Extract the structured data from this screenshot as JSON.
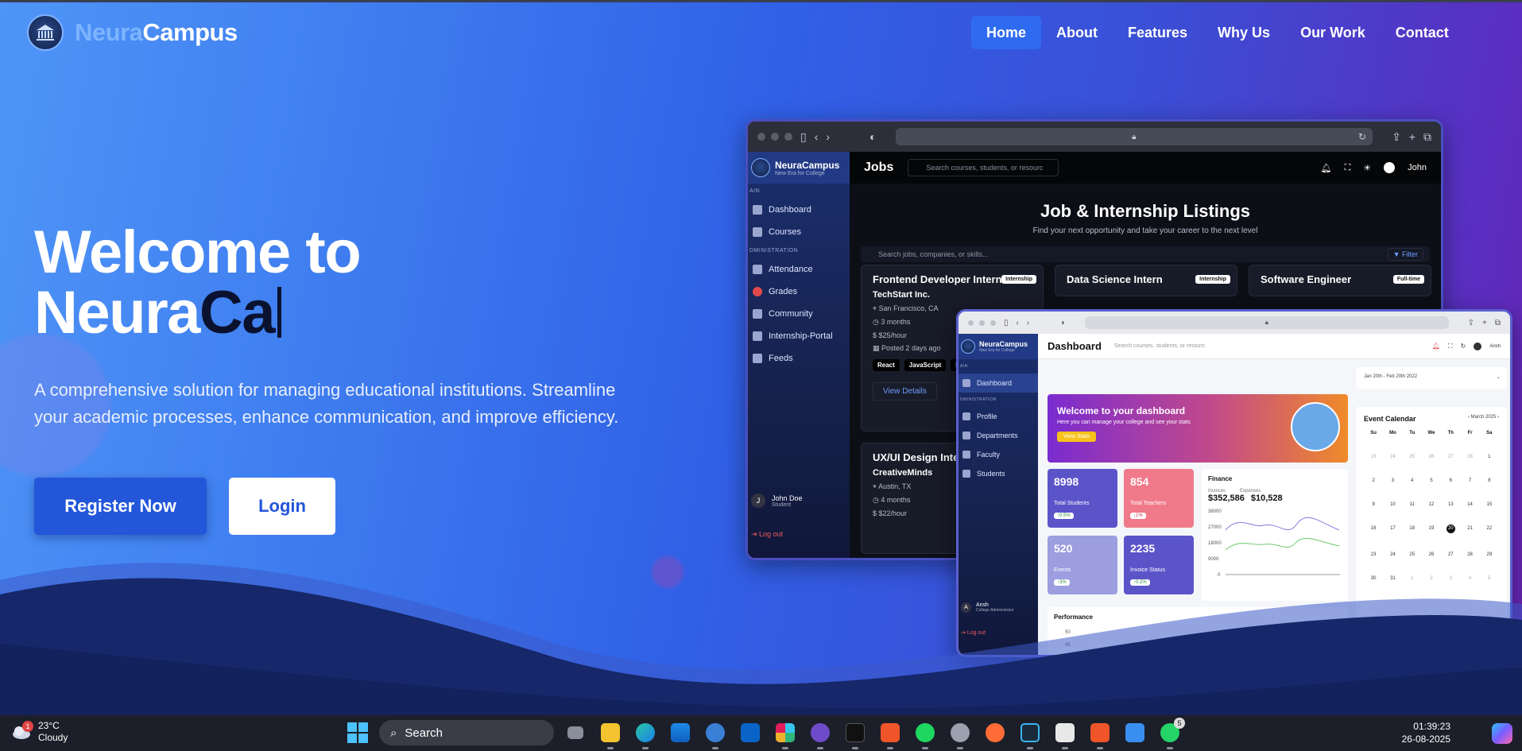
{
  "colors": {
    "accent": "#2356d9",
    "nav_active": "#2f6bf0",
    "brand_light": "#7db4ff"
  },
  "brand": {
    "part1": "Neura",
    "part2": "Campus"
  },
  "nav": [
    {
      "label": "Home",
      "active": true
    },
    {
      "label": "About"
    },
    {
      "label": "Features"
    },
    {
      "label": "Why Us"
    },
    {
      "label": "Our Work"
    },
    {
      "label": "Contact"
    }
  ],
  "hero": {
    "line1": "Welcome to",
    "line2_prefix": "Neura",
    "line2_typed": "Ca",
    "subtitle": "A comprehensive solution for managing educational institutions. Streamline your academic processes, enhance communication, and improve efficiency.",
    "register_label": "Register Now",
    "login_label": "Login"
  },
  "jobs_window": {
    "brand_title": "NeuraCampus",
    "brand_sub": "New Era for College",
    "sections": {
      "main": "AIN",
      "admin": "DMINISTRATION"
    },
    "sidebar": [
      "Dashboard",
      "Courses",
      "Attendance",
      "Grades",
      "Community",
      "Internship-Portal",
      "Feeds"
    ],
    "user_name": "John Doe",
    "user_role": "Student",
    "logout": "Log out",
    "user_initial": "J",
    "page_title": "Jobs",
    "search_placeholder": "Search courses, students, or resourc",
    "header_user": "John",
    "listing_title": "Job & Internship Listings",
    "listing_sub": "Find your next opportunity and take your career to the next level",
    "job_search": "Search jobs, companies, or skills...",
    "filter": "Filter",
    "cards": [
      {
        "title": "Frontend Developer Intern",
        "badge": "Internship",
        "company": "TechStart Inc.",
        "location": "San Francisco, CA",
        "duration": "3 months",
        "pay": "$25/hour",
        "posted": "Posted 2 days ago",
        "tags": [
          "React",
          "JavaScript",
          "HTM"
        ],
        "action": "View Details"
      },
      {
        "title": "Data Science Intern",
        "badge": "Internship"
      },
      {
        "title": "Software Engineer",
        "badge": "Full-time"
      },
      {
        "title": "UX/UI Design Intern",
        "company": "CreativeMinds",
        "location": "Austin, TX",
        "duration": "4 months",
        "pay": "$22/hour"
      }
    ]
  },
  "dash_window": {
    "brand_title": "NeuraCampus",
    "brand_sub": "New Era for College",
    "sections": {
      "main": "AIN",
      "admin": "DMINISTRATION"
    },
    "sidebar": [
      "Dashboard",
      "Profile",
      "Departments",
      "Faculty",
      "Students"
    ],
    "user_name": "Ansh",
    "user_role": "College Administrator",
    "logout": "Log out",
    "user_initial": "A",
    "page_title": "Dashboard",
    "search_placeholder": "Search courses, students, or resourc",
    "header_user": "Ansh",
    "welcome_title": "Welcome to your dashboard",
    "welcome_sub": "Here you can manage your college and see your stats",
    "welcome_btn": "View Stats",
    "stats": [
      {
        "value": "8998",
        "label": "Total Students",
        "pct": "↑0.5%",
        "color": "#5b54c9"
      },
      {
        "value": "854",
        "label": "Total Teachers",
        "pct": "↓1%",
        "color": "#f07a8a"
      },
      {
        "value": "520",
        "label": "Events",
        "pct": "↑3%",
        "color": "#9c9ee0"
      },
      {
        "value": "2235",
        "label": "Invoice Status",
        "pct": "↑0.2%",
        "color": "#5b54c9"
      }
    ],
    "finance": {
      "title": "Finance",
      "invoices_label": "Invoices",
      "expenses_label": "Expenses",
      "invoices": "$352,586",
      "expenses": "$10,528",
      "yticks": [
        "36000",
        "27000",
        "18000",
        "9000",
        "0"
      ]
    },
    "date_range": "Jan 20th - Feb 20th 2022",
    "calendar": {
      "title": "Event Calendar",
      "month": "March 2025",
      "days": [
        "Su",
        "Mo",
        "Tu",
        "We",
        "Th",
        "Fr",
        "Sa"
      ],
      "cells": [
        "23",
        "24",
        "25",
        "26",
        "27",
        "28",
        "1",
        "2",
        "3",
        "4",
        "5",
        "6",
        "7",
        "8",
        "9",
        "10",
        "11",
        "12",
        "13",
        "14",
        "15",
        "16",
        "17",
        "18",
        "19",
        "20",
        "21",
        "22",
        "23",
        "24",
        "25",
        "26",
        "27",
        "28",
        "29",
        "30",
        "31",
        "1",
        "2",
        "3",
        "4",
        "5"
      ],
      "today": "20"
    },
    "performance": {
      "title": "Performance",
      "yticks": [
        "50",
        "45"
      ]
    }
  },
  "taskbar": {
    "temp": "23°C",
    "condition": "Cloudy",
    "weather_badge": "1",
    "search": "Search",
    "whatsapp_badge": "5",
    "time": "01:39:23",
    "date": "26-08-2025",
    "apps": [
      "file-explorer-icon",
      "folder-icon",
      "edge-icon",
      "store-icon",
      "python-icon",
      "outlook-icon",
      "slack-icon",
      "github-icon",
      "terminal-icon",
      "brave-icon",
      "spotify-icon",
      "settings-icon",
      "postman-icon",
      "code-icon",
      "editor-icon",
      "brave-2-icon",
      "notepad-icon",
      "whatsapp-icon"
    ]
  }
}
